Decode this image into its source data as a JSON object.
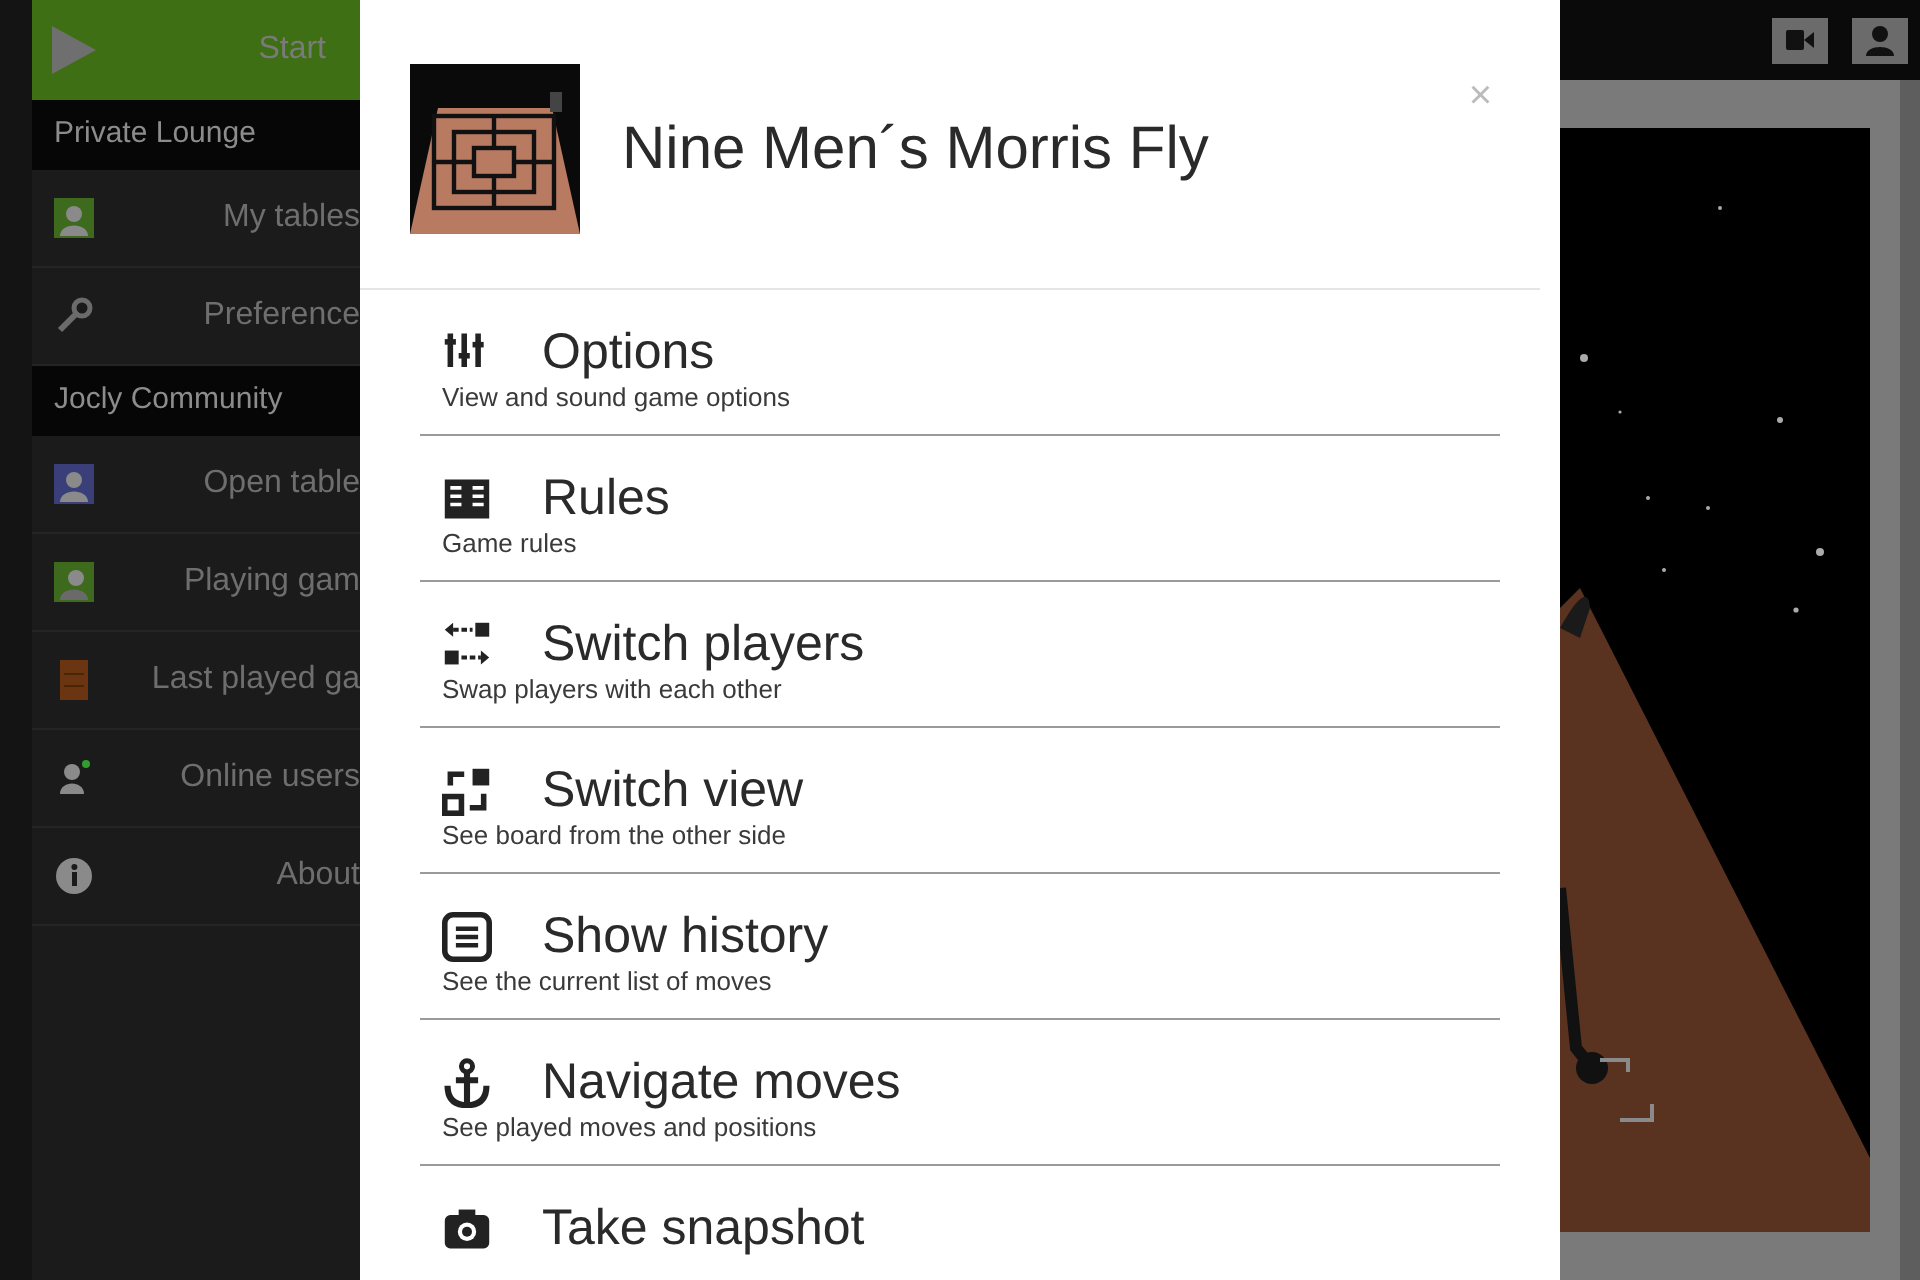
{
  "sidebar": {
    "items": [
      {
        "kind": "start",
        "label": "Start"
      },
      {
        "kind": "header",
        "label": "Private Lounge"
      },
      {
        "kind": "item",
        "label": "My tables"
      },
      {
        "kind": "item",
        "label": "Preference"
      },
      {
        "kind": "header",
        "label": "Jocly Community"
      },
      {
        "kind": "item",
        "label": "Open table"
      },
      {
        "kind": "item",
        "label": "Playing gam"
      },
      {
        "kind": "item",
        "label": "Last played ga"
      },
      {
        "kind": "item",
        "label": "Online users"
      },
      {
        "kind": "item",
        "label": "About"
      }
    ]
  },
  "dialog": {
    "title": "Nine Men´s Morris Fly",
    "close": "×",
    "items": [
      {
        "title": "Options",
        "subtitle": "View and sound game options"
      },
      {
        "title": "Rules",
        "subtitle": "Game rules"
      },
      {
        "title": "Switch players",
        "subtitle": "Swap players with each other"
      },
      {
        "title": "Switch view",
        "subtitle": "See board from the other side"
      },
      {
        "title": "Show history",
        "subtitle": "See the current list of moves"
      },
      {
        "title": "Navigate moves",
        "subtitle": "See played moves and positions"
      },
      {
        "title": "Take snapshot"
      }
    ]
  }
}
